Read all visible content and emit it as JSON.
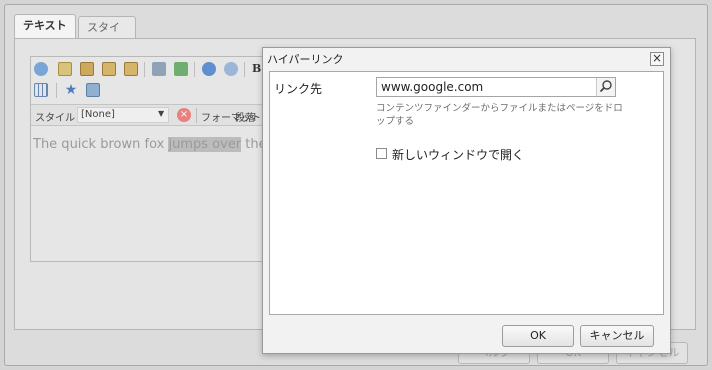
{
  "tabs": [
    {
      "label": "テキスト"
    },
    {
      "label": "スタイル"
    }
  ],
  "editor": {
    "style_label": "スタイル",
    "style_value": "[None]",
    "format_label": "フォーマット",
    "paragraph_label": "段落",
    "text_before": "The quick brown fox ",
    "text_highlight": "jumps over",
    "text_after": " the"
  },
  "outer_buttons": [
    {
      "label": "ヘルプ"
    },
    {
      "label": "OK"
    },
    {
      "label": "キャンセル"
    }
  ],
  "dialog": {
    "title": "ハイパーリンク",
    "close_label": "×",
    "link_label": "リンク先",
    "link_value": "www.google.com",
    "hint": "コンテンツファインダーからファイルまたはページをドロップする",
    "new_window_label": "新しいウィンドウで開く",
    "new_window_checked": false,
    "ok_label": "OK",
    "cancel_label": "キャンセル"
  },
  "colors": {
    "background": "#d4d4d4",
    "dialog_body": "#ffffff",
    "highlight": "#bcbcbc",
    "clear_icon": "#e88080"
  }
}
